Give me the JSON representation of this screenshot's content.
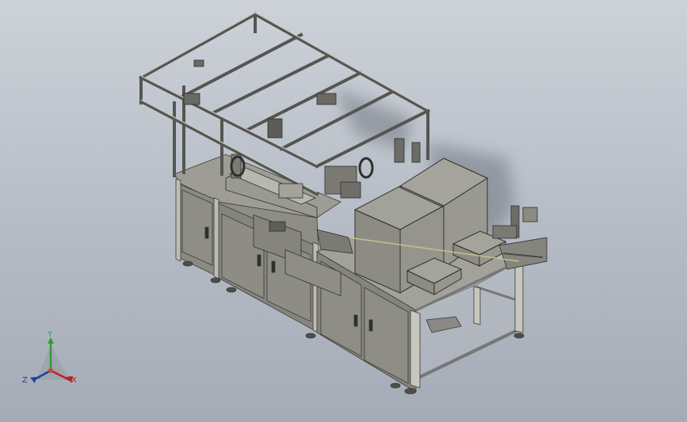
{
  "viewport": {
    "background_top": "#cdd2d9",
    "background_bottom": "#a5acb7",
    "model_color": "#8d8c83",
    "frame_color": "#7a7b78"
  },
  "triad": {
    "y_label": "Y",
    "z_label": "Z",
    "x_label": "X",
    "y_color": "#2f9c38",
    "z_color": "#1f3f9a",
    "x_color": "#b52222"
  }
}
